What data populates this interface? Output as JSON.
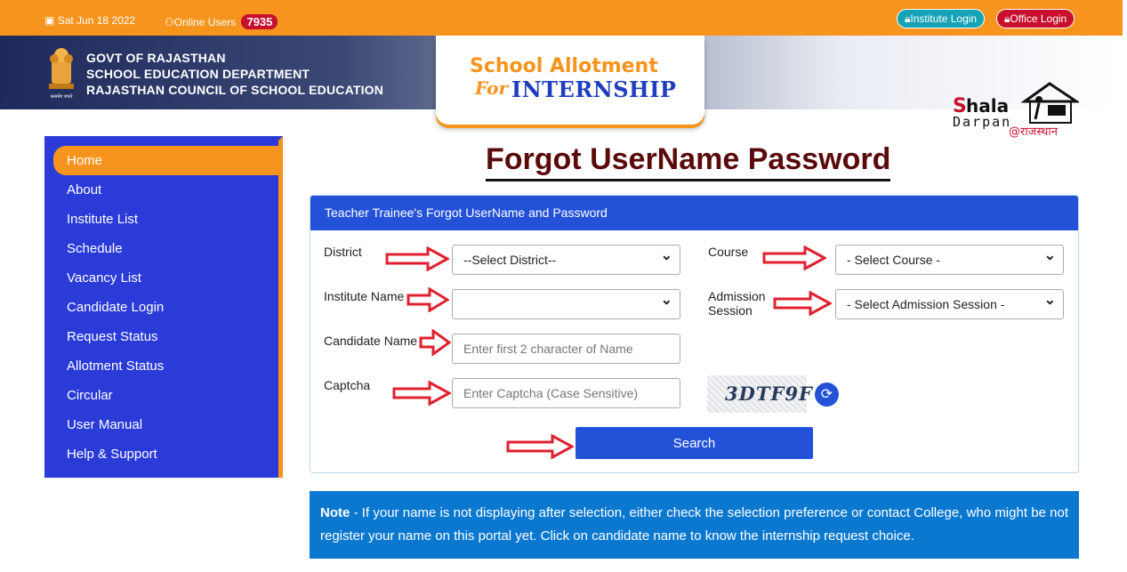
{
  "topbar": {
    "date_icon": "calendar-icon",
    "date": "Sat Jun 18 2022",
    "online_icon": "user-icon",
    "online_label": "Online Users",
    "online_count": "7935",
    "institute_login": "Institute Login",
    "office_login": "Office Login"
  },
  "header": {
    "emblem_caption": "सत्यमेव जयते",
    "line1": "GOVT OF RAJASTHAN",
    "line2": "SCHOOL EDUCATION DEPARTMENT",
    "line3": "RAJASTHAN COUNCIL OF SCHOOL EDUCATION",
    "logo_title": "School Allotment",
    "logo_for": "For",
    "logo_sub": "INTERNSHIP",
    "shala_s": "S",
    "shala_rest": "hala",
    "darpan": "Darpan",
    "rajasthan": "@राजस्थान"
  },
  "sidebar": {
    "items": [
      {
        "label": "Home",
        "active": true
      },
      {
        "label": "About"
      },
      {
        "label": "Institute List"
      },
      {
        "label": "Schedule"
      },
      {
        "label": "Vacancy List"
      },
      {
        "label": "Candidate Login"
      },
      {
        "label": "Request Status"
      },
      {
        "label": "Allotment Status"
      },
      {
        "label": "Circular"
      },
      {
        "label": "User Manual"
      },
      {
        "label": "Help & Support"
      }
    ]
  },
  "main": {
    "title": "Forgot UserName Password",
    "panel_title": "Teacher Trainee's Forgot UserName and Password",
    "district_label": "District",
    "district_value": "--Select District--",
    "course_label": "Course",
    "course_value": "- Select Course -",
    "institute_label": "Institute Name",
    "institute_value": "",
    "session_label_1": "Admission",
    "session_label_2": "Session",
    "session_value": "- Select Admission Session -",
    "candidate_label": "Candidate Name",
    "candidate_placeholder": "Enter first 2 character of Name",
    "captcha_label": "Captcha",
    "captcha_placeholder": "Enter Captcha (Case Sensitive)",
    "captcha_text": "3DTF9F",
    "search": "Search"
  },
  "note": {
    "lead": "Note",
    "text": " - If your name is not displaying after selection, either check the selection preference or contact College, who might be not register your name on this portal yet. Click on candidate name to know the internship request choice."
  },
  "colors": {
    "orange": "#f7941d",
    "blue": "#2352d8",
    "sidebar": "#2a3bd8",
    "arrow_red": "#e0202e",
    "note_bg": "#0b78d0"
  }
}
